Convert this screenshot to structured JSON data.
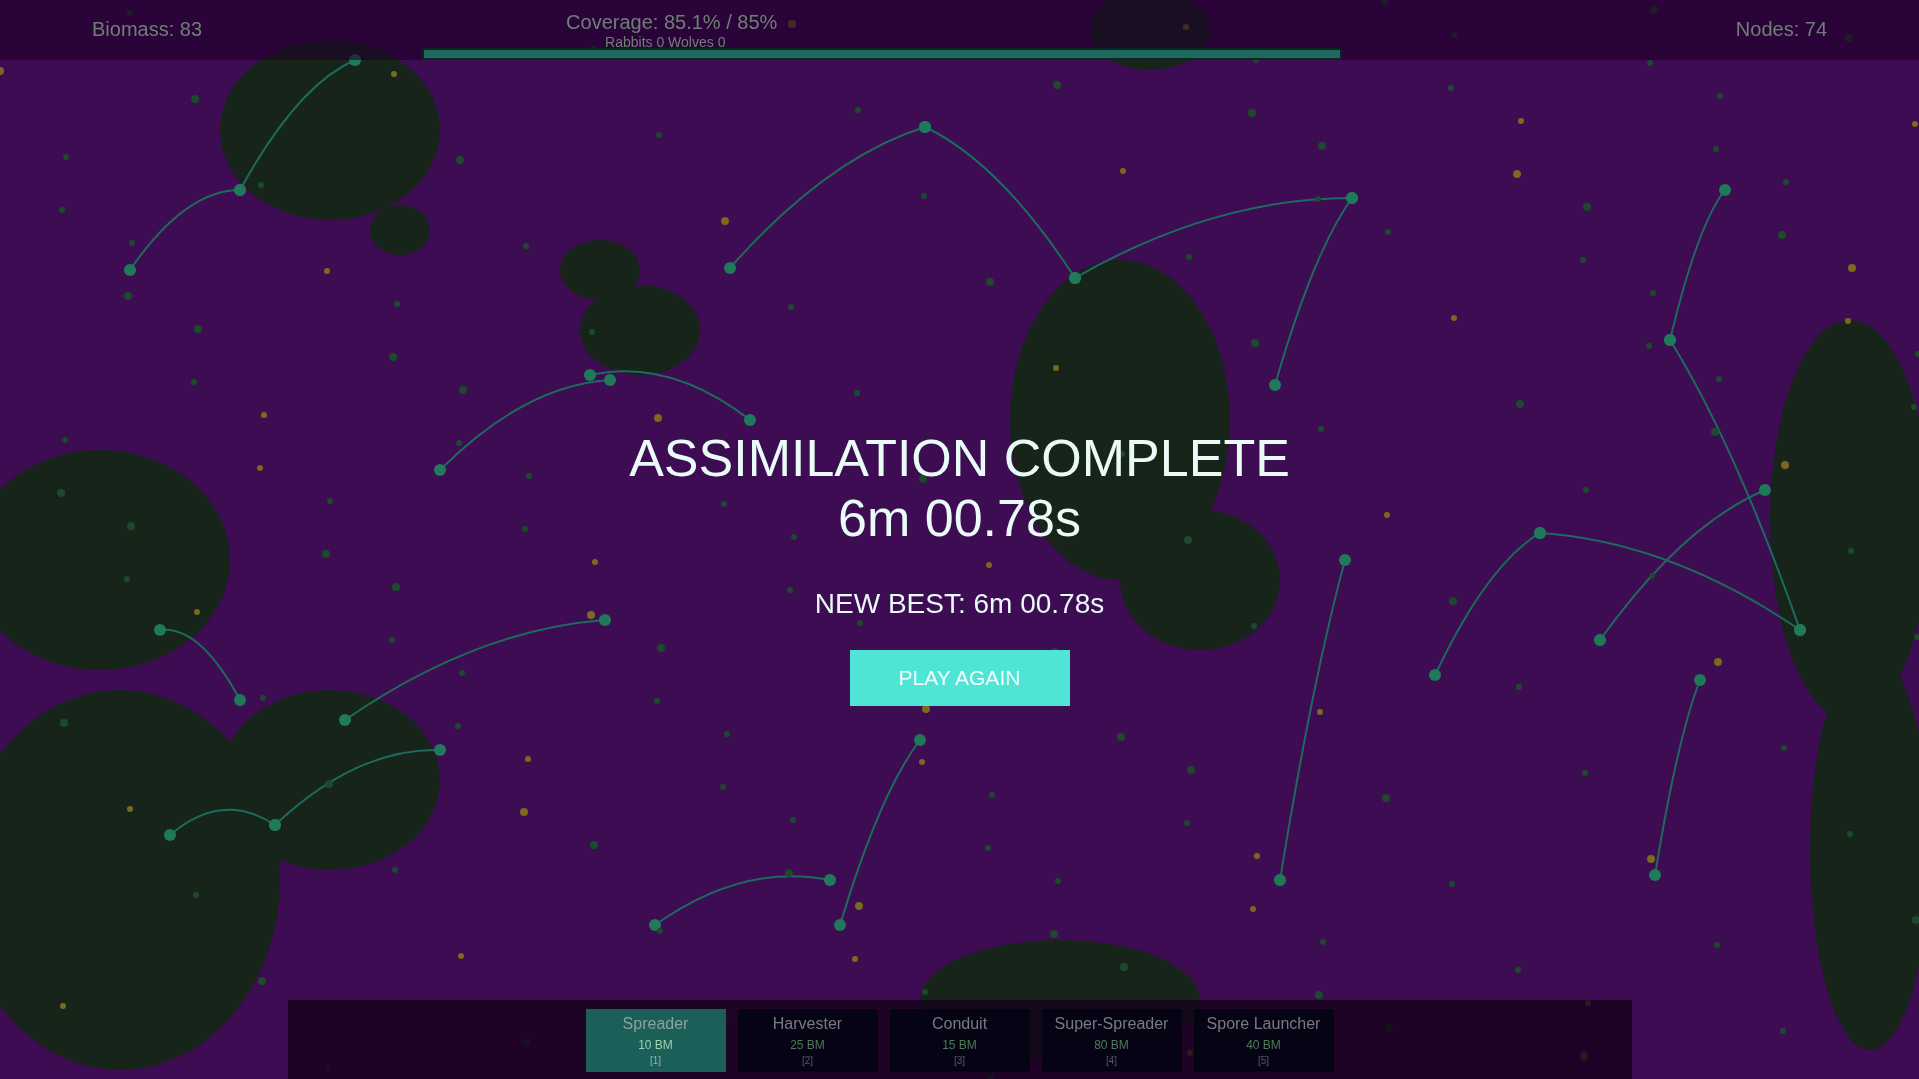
{
  "hud": {
    "biomass": "Biomass: 83",
    "coverage": "Coverage: 85.1%  /  85%",
    "population": "Rabbits 0  Wolves 0",
    "coverage_bar": {
      "level": 1.0
    },
    "nodes": "Nodes: 74"
  },
  "result": {
    "title": "ASSIMILATION COMPLETE",
    "time": "6m 00.78s",
    "best": "NEW BEST: 6m 00.78s",
    "button": "PLAY AGAIN"
  },
  "tools": [
    {
      "name": "Spreader",
      "cost": "10 BM",
      "key": "[1]",
      "selected": true
    },
    {
      "name": "Harvester",
      "cost": "25 BM",
      "key": "[2]",
      "selected": false
    },
    {
      "name": "Conduit",
      "cost": "15 BM",
      "key": "[3]",
      "selected": false
    },
    {
      "name": "Super-Spreader",
      "cost": "80 BM",
      "key": "[4]",
      "selected": false
    },
    {
      "name": "Spore Launcher",
      "cost": "40 BM",
      "key": "[5]",
      "selected": false
    }
  ]
}
